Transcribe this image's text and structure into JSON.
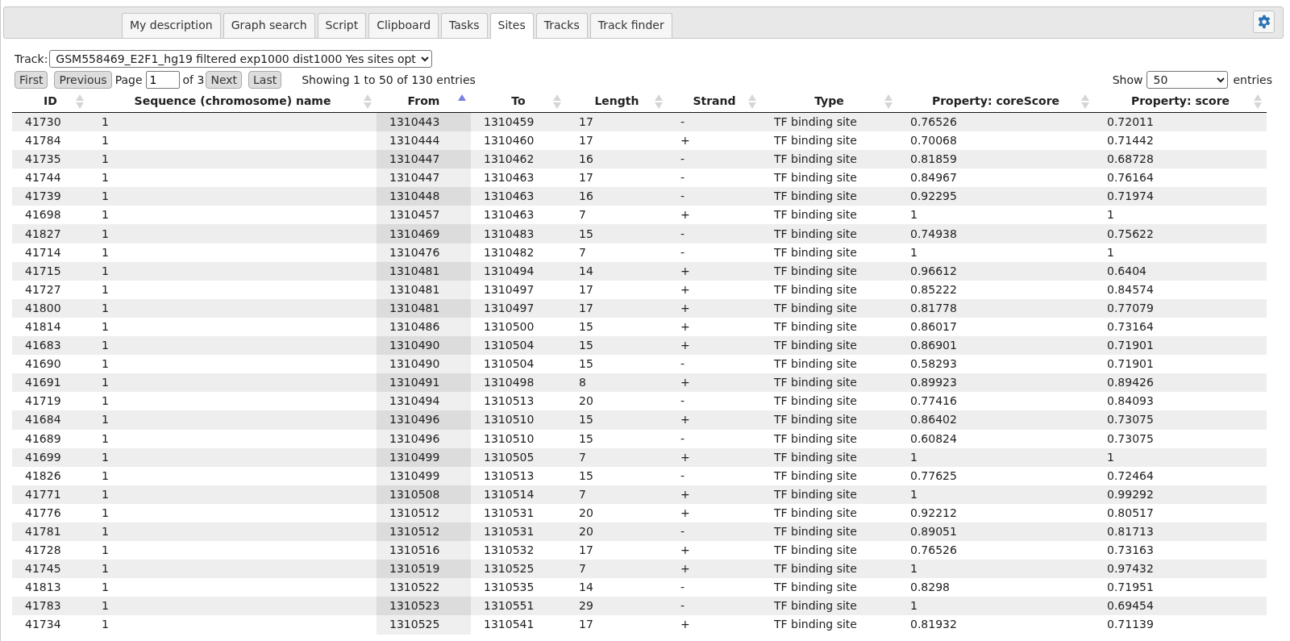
{
  "tabs": [
    {
      "label": "My description",
      "selected": false
    },
    {
      "label": "Graph search",
      "selected": false
    },
    {
      "label": "Script",
      "selected": false
    },
    {
      "label": "Clipboard",
      "selected": false
    },
    {
      "label": "Tasks",
      "selected": false
    },
    {
      "label": "Sites",
      "selected": true
    },
    {
      "label": "Tracks",
      "selected": false
    },
    {
      "label": "Track finder",
      "selected": false
    }
  ],
  "track": {
    "label": "Track:",
    "value": "GSM558469_E2F1_hg19 filtered exp1000 dist1000 Yes sites opt"
  },
  "pager": {
    "first": "First",
    "previous": "Previous",
    "page_label": "Page",
    "page": "1",
    "of": "of 3",
    "next": "Next",
    "last": "Last",
    "info": "Showing 1 to 50 of 130 entries"
  },
  "length_menu": {
    "before": "Show",
    "value": "50",
    "after": "entries"
  },
  "table": {
    "columns": [
      {
        "label": "ID",
        "sorted": false
      },
      {
        "label": "Sequence (chromosome) name",
        "sorted": false
      },
      {
        "label": "From",
        "sorted": true
      },
      {
        "label": "To",
        "sorted": false
      },
      {
        "label": "Length",
        "sorted": false
      },
      {
        "label": "Strand",
        "sorted": false
      },
      {
        "label": "Type",
        "sorted": false
      },
      {
        "label": "Property: coreScore",
        "sorted": false
      },
      {
        "label": "Property: score",
        "sorted": false
      }
    ],
    "rows": [
      [
        "41730",
        "1",
        "1310443",
        "1310459",
        "17",
        "-",
        "TF binding site",
        "0.76526",
        "0.72011"
      ],
      [
        "41784",
        "1",
        "1310444",
        "1310460",
        "17",
        "+",
        "TF binding site",
        "0.70068",
        "0.71442"
      ],
      [
        "41735",
        "1",
        "1310447",
        "1310462",
        "16",
        "-",
        "TF binding site",
        "0.81859",
        "0.68728"
      ],
      [
        "41744",
        "1",
        "1310447",
        "1310463",
        "17",
        "-",
        "TF binding site",
        "0.84967",
        "0.76164"
      ],
      [
        "41739",
        "1",
        "1310448",
        "1310463",
        "16",
        "-",
        "TF binding site",
        "0.92295",
        "0.71974"
      ],
      [
        "41698",
        "1",
        "1310457",
        "1310463",
        "7",
        "+",
        "TF binding site",
        "1",
        "1"
      ],
      [
        "41827",
        "1",
        "1310469",
        "1310483",
        "15",
        "-",
        "TF binding site",
        "0.74938",
        "0.75622"
      ],
      [
        "41714",
        "1",
        "1310476",
        "1310482",
        "7",
        "-",
        "TF binding site",
        "1",
        "1"
      ],
      [
        "41715",
        "1",
        "1310481",
        "1310494",
        "14",
        "+",
        "TF binding site",
        "0.96612",
        "0.6404"
      ],
      [
        "41727",
        "1",
        "1310481",
        "1310497",
        "17",
        "+",
        "TF binding site",
        "0.85222",
        "0.84574"
      ],
      [
        "41800",
        "1",
        "1310481",
        "1310497",
        "17",
        "+",
        "TF binding site",
        "0.81778",
        "0.77079"
      ],
      [
        "41814",
        "1",
        "1310486",
        "1310500",
        "15",
        "+",
        "TF binding site",
        "0.86017",
        "0.73164"
      ],
      [
        "41683",
        "1",
        "1310490",
        "1310504",
        "15",
        "+",
        "TF binding site",
        "0.86901",
        "0.71901"
      ],
      [
        "41690",
        "1",
        "1310490",
        "1310504",
        "15",
        "-",
        "TF binding site",
        "0.58293",
        "0.71901"
      ],
      [
        "41691",
        "1",
        "1310491",
        "1310498",
        "8",
        "+",
        "TF binding site",
        "0.89923",
        "0.89426"
      ],
      [
        "41719",
        "1",
        "1310494",
        "1310513",
        "20",
        "-",
        "TF binding site",
        "0.77416",
        "0.84093"
      ],
      [
        "41684",
        "1",
        "1310496",
        "1310510",
        "15",
        "+",
        "TF binding site",
        "0.86402",
        "0.73075"
      ],
      [
        "41689",
        "1",
        "1310496",
        "1310510",
        "15",
        "-",
        "TF binding site",
        "0.60824",
        "0.73075"
      ],
      [
        "41699",
        "1",
        "1310499",
        "1310505",
        "7",
        "+",
        "TF binding site",
        "1",
        "1"
      ],
      [
        "41826",
        "1",
        "1310499",
        "1310513",
        "15",
        "-",
        "TF binding site",
        "0.77625",
        "0.72464"
      ],
      [
        "41771",
        "1",
        "1310508",
        "1310514",
        "7",
        "+",
        "TF binding site",
        "1",
        "0.99292"
      ],
      [
        "41776",
        "1",
        "1310512",
        "1310531",
        "20",
        "+",
        "TF binding site",
        "0.92212",
        "0.80517"
      ],
      [
        "41781",
        "1",
        "1310512",
        "1310531",
        "20",
        "-",
        "TF binding site",
        "0.89051",
        "0.81713"
      ],
      [
        "41728",
        "1",
        "1310516",
        "1310532",
        "17",
        "+",
        "TF binding site",
        "0.76526",
        "0.73163"
      ],
      [
        "41745",
        "1",
        "1310519",
        "1310525",
        "7",
        "+",
        "TF binding site",
        "1",
        "0.97432"
      ],
      [
        "41813",
        "1",
        "1310522",
        "1310535",
        "14",
        "-",
        "TF binding site",
        "0.8298",
        "0.71951"
      ],
      [
        "41783",
        "1",
        "1310523",
        "1310551",
        "29",
        "-",
        "TF binding site",
        "1",
        "0.69454"
      ],
      [
        "41734",
        "1",
        "1310525",
        "1310541",
        "17",
        "+",
        "TF binding site",
        "0.81932",
        "0.71139"
      ]
    ]
  }
}
